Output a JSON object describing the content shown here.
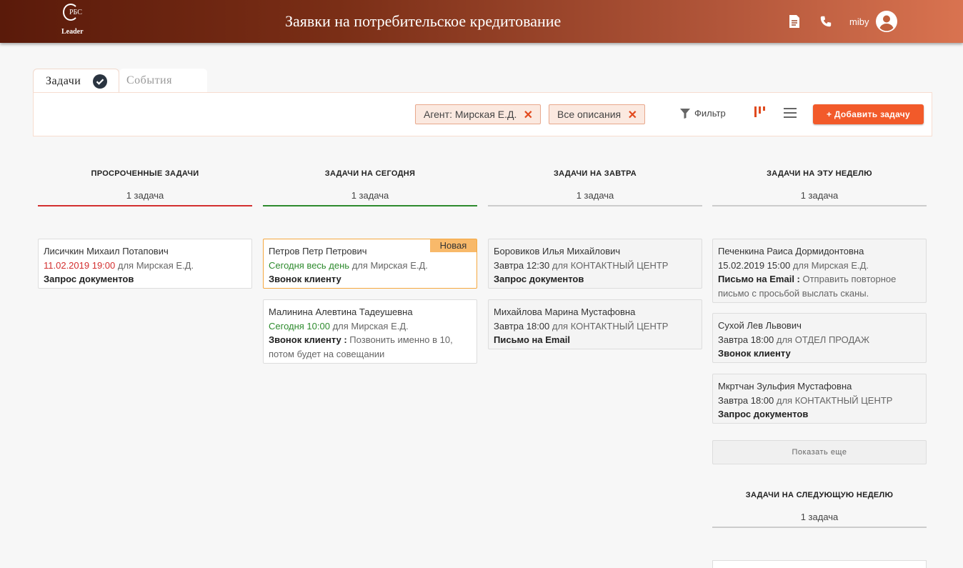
{
  "header": {
    "logo_top": "РБС",
    "logo_bottom": "Leader",
    "title": "Заявки на потребительское кредитование",
    "user_name": "miby",
    "icons": [
      "document-icon",
      "phone-icon",
      "account-circle-icon"
    ]
  },
  "tabs": [
    {
      "label": "Задачи",
      "active": true
    },
    {
      "label": "События",
      "active": false
    }
  ],
  "toolbar": {
    "chips": [
      {
        "label": "Агент: Мирская Е.Д."
      },
      {
        "label": "Все описания"
      }
    ],
    "chip_close": "✕",
    "filter_label": "Фильтр",
    "add_label": "+ Добавить задачу"
  },
  "colors": {
    "accent": "#f25a2a",
    "overdue": "#d32f2f",
    "today": "#2e8b2e",
    "new_badge": "#f8b96a"
  },
  "columns": [
    {
      "title": "ПРОСРОЧЕННЫЕ ЗАДАЧИ",
      "count": "1 задача",
      "cards": [
        {
          "name": "Лисичкин Михаил Потапович",
          "when": "11.02.2019 19:00",
          "for": " для ",
          "assignee": "Мирская Е.Д.",
          "type": "Запрос документов",
          "desc": ""
        }
      ]
    },
    {
      "title": "ЗАДАЧИ НА СЕГОДНЯ",
      "count": "1 задача",
      "cards": [
        {
          "name": "Петров Петр Петрович",
          "badge": "Новая",
          "when": "Сегодня весь день",
          "for": " для ",
          "assignee": "Мирская Е.Д.",
          "type": "Звонок клиенту",
          "desc": ""
        },
        {
          "name": "Малинина Алевтина Тадеушевна",
          "when": "Сегодня 10:00",
          "for": " для ",
          "assignee": "Мирская Е.Д.",
          "type": "Звонок клиенту :",
          "desc": " Позвонить именно в 10, потом будет на совещании"
        }
      ]
    },
    {
      "title": "ЗАДАЧИ НА ЗАВТРА",
      "count": "1 задача",
      "cards": [
        {
          "name": "Боровиков Илья Михайлович",
          "when": "Завтра 12:30",
          "for": " для ",
          "assignee": "КОНТАКТНЫЙ ЦЕНТР",
          "type": "Запрос документов",
          "desc": ""
        },
        {
          "name": "Михайлова Марина Мустафовна",
          "when": "Завтра 18:00",
          "for": " для ",
          "assignee": "КОНТАКТНЫЙ ЦЕНТР",
          "type": "Письмо на Email",
          "desc": ""
        }
      ]
    },
    {
      "title": "ЗАДАЧИ НА ЭТУ НЕДЕЛЮ",
      "count": "1 задача",
      "cards": [
        {
          "name": "Печенкина Раиса Дормидонтовна",
          "when": "15.02.2019 15:00",
          "for": " для ",
          "assignee": "Мирская Е.Д.",
          "type": "Письмо на Email :",
          "desc": " Отправить повторное письмо с просьбой выслать сканы."
        },
        {
          "name": "Сухой Лев Львович",
          "when": "Завтра 18:00",
          "for": " для ",
          "assignee": "ОТДЕЛ ПРОДАЖ",
          "type": "Звонок клиенту",
          "desc": ""
        },
        {
          "name": "Мкртчан Зульфия Мустафовна",
          "when": "Завтра 18:00",
          "for": " для ",
          "assignee": "КОНТАКТНЫЙ ЦЕНТР",
          "type": "Запрос документов",
          "desc": ""
        }
      ],
      "show_more": "Показать еще"
    },
    {
      "title": "ЗАДАЧИ НА СЛЕДУЮЩУЮ НЕДЕЛЮ",
      "count": "1 задача",
      "cards": []
    }
  ]
}
